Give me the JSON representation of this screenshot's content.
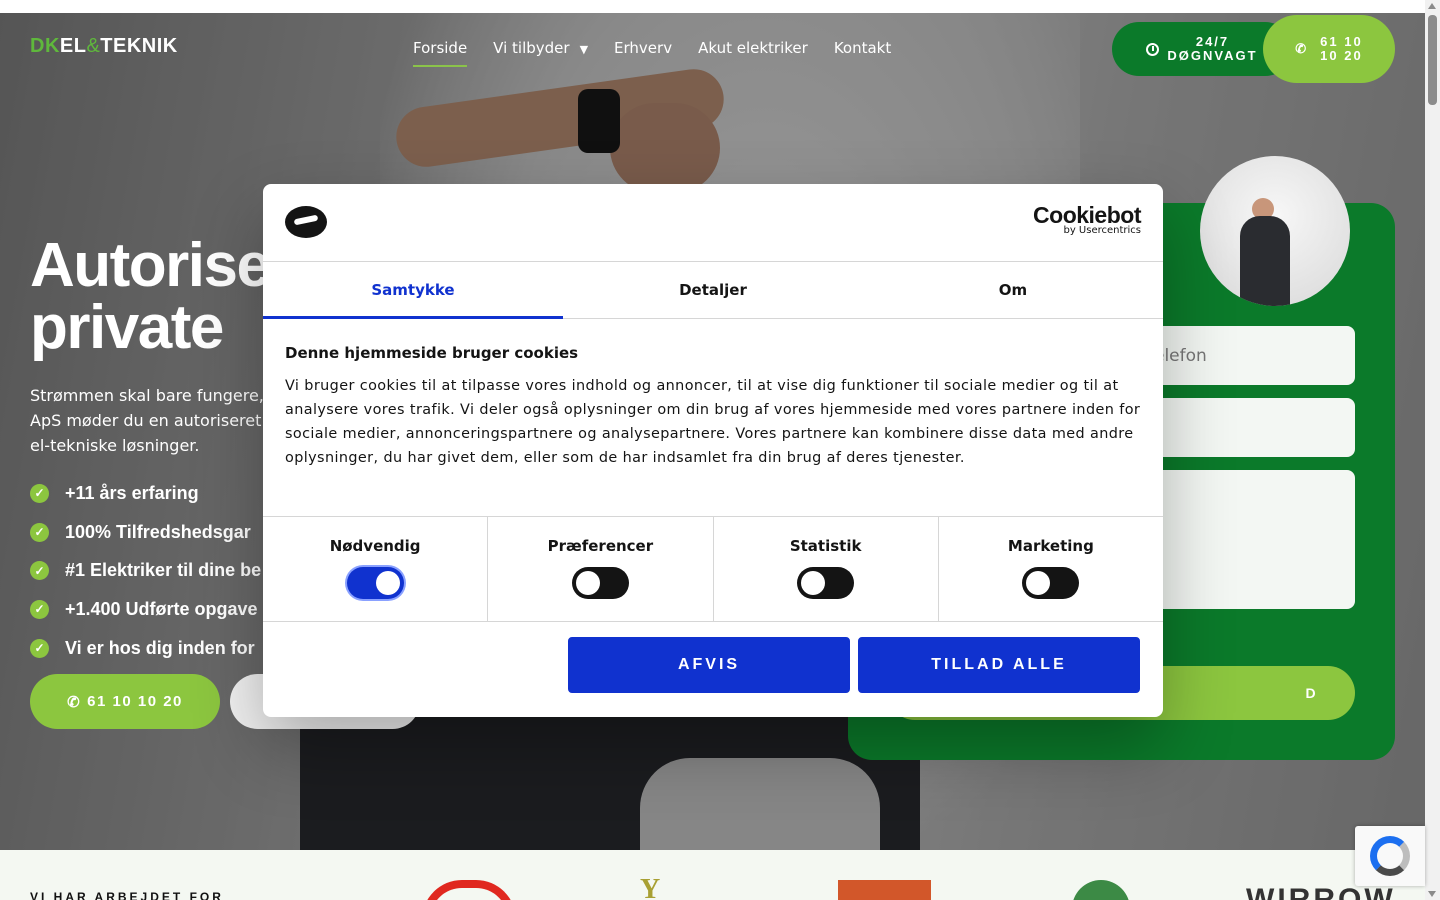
{
  "header": {
    "logo": {
      "part1": "DK",
      "part2": "EL",
      "amp": "&",
      "part3": "TEKNIK"
    },
    "nav": [
      {
        "label": "Forside",
        "active": true
      },
      {
        "label": "Vi tilbyder",
        "has_dropdown": true
      },
      {
        "label": "Erhverv"
      },
      {
        "label": "Akut elektriker"
      },
      {
        "label": "Kontakt"
      }
    ],
    "emergency_btn": {
      "line1": "24/7",
      "line2": "DØGNVAGT",
      "icon": "clock-icon"
    },
    "phone_btn": {
      "line1": "61 10",
      "line2": "10 20",
      "icon": "phone-icon"
    }
  },
  "hero": {
    "title_line1": "Autorise",
    "title_line2": "private",
    "lead_line1": "Strømmen skal bare fungere,",
    "lead_line2": "ApS møder du en autoriseret e",
    "lead_line3": "el-tekniske løsninger.",
    "usps": [
      "+11 års erfaring",
      "100% Tilfredshedsgar",
      "#1 Elektriker til dine be",
      "+1.400 Udførte opgave",
      "Vi er hos dig inden for"
    ],
    "call_btn": "61 10 10 20"
  },
  "form": {
    "phone_placeholder": "elefon",
    "submit_label": "D"
  },
  "clients": {
    "label": "VI HAR ARBEJDET FOR",
    "logo_text_2": "Y",
    "logo_text_5": "WIRROW"
  },
  "cookie_dialog": {
    "brand": "Cookiebot",
    "brand_sub": "by Usercentrics",
    "tabs": [
      {
        "label": "Samtykke",
        "active": true
      },
      {
        "label": "Detaljer"
      },
      {
        "label": "Om"
      }
    ],
    "heading": "Denne hjemmeside bruger cookies",
    "body": "Vi bruger cookies til at tilpasse vores indhold og annoncer, til at vise dig funktioner til sociale medier og til at analysere vores trafik. Vi deler også oplysninger om din brug af vores hjemmeside med vores partnere inden for sociale medier, annonceringspartnere og analysepartnere. Vores partnere kan kombinere disse data med andre oplysninger, du har givet dem, eller som de har indsamlet fra din brug af deres tjenester.",
    "categories": [
      {
        "label": "Nødvendig",
        "enabled": true
      },
      {
        "label": "Præferencer",
        "enabled": false
      },
      {
        "label": "Statistik",
        "enabled": false
      },
      {
        "label": "Marketing",
        "enabled": false
      }
    ],
    "decline_label": "AFVIS",
    "accept_label": "TILLAD ALLE"
  },
  "colors": {
    "accent_green": "#8cc63f",
    "dark_green": "#0b7a2a",
    "cookie_blue": "#1032cf"
  }
}
